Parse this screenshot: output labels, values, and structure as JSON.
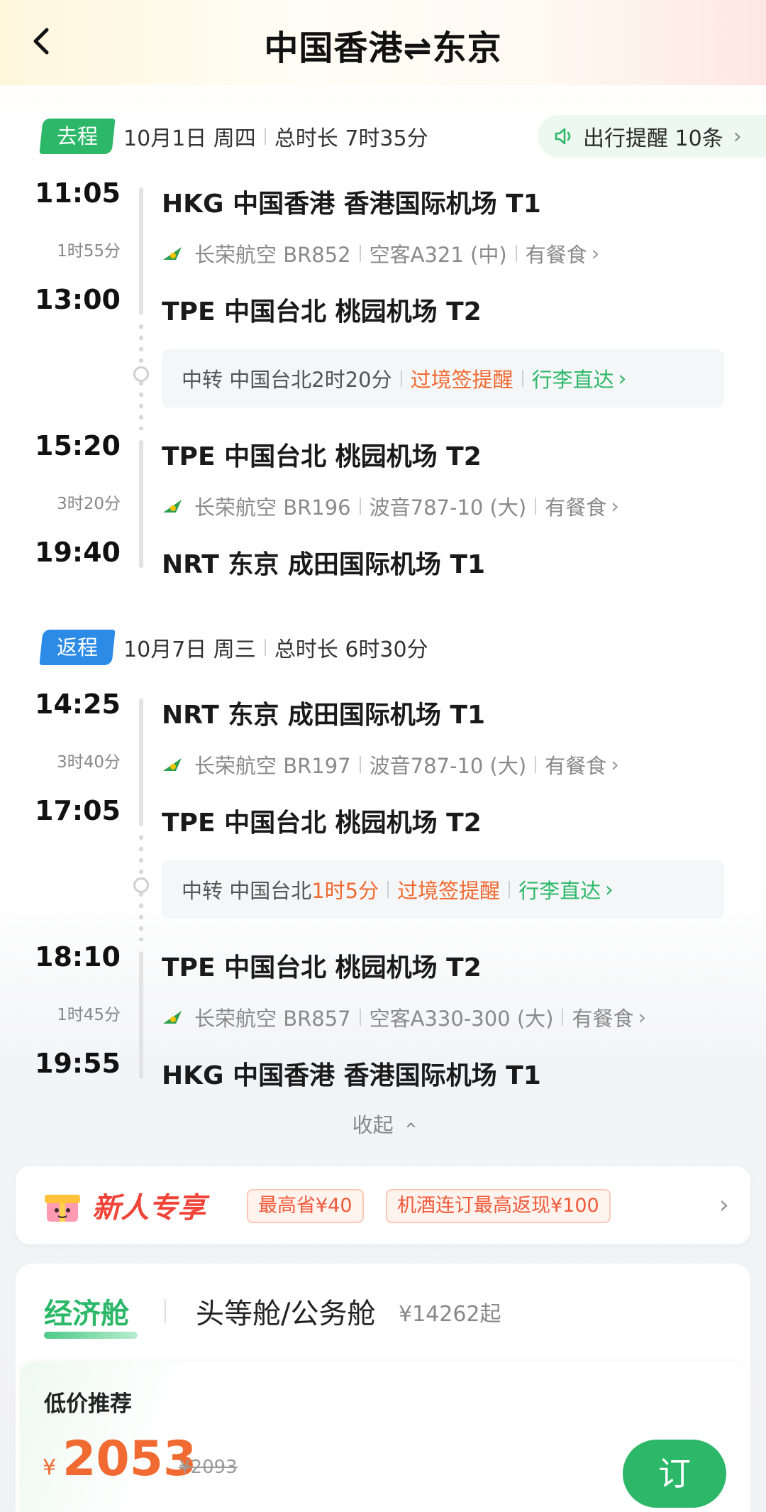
{
  "header": {
    "title": "中国香港⇌东京"
  },
  "outbound": {
    "tag": "去程",
    "date": "10月1日 周四",
    "total_duration": "总时长 7时35分",
    "reminder": "出行提醒 10条",
    "legs": [
      {
        "dep_time": "11:05",
        "duration": "1时55分",
        "arr_time": "13:00",
        "dep_airport": "HKG 中国香港 香港国际机场 T1",
        "airline": "长荣航空 BR852",
        "aircraft": "空客A321 (中)",
        "meal": "有餐食",
        "arr_airport": "TPE 中国台北 桃园机场 T2"
      },
      {
        "dep_time": "15:20",
        "duration": "3时20分",
        "arr_time": "19:40",
        "dep_airport": "TPE 中国台北 桃园机场 T2",
        "airline": "长荣航空 BR196",
        "aircraft": "波音787-10 (大)",
        "meal": "有餐食",
        "arr_airport": "NRT 东京 成田国际机场 T1"
      }
    ],
    "transfer": {
      "city": "中转 中国台北",
      "time": "2时20分",
      "visa": "过境签提醒",
      "baggage": "行李直达"
    }
  },
  "return": {
    "tag": "返程",
    "date": "10月7日 周三",
    "total_duration": "总时长 6时30分",
    "legs": [
      {
        "dep_time": "14:25",
        "duration": "3时40分",
        "arr_time": "17:05",
        "dep_airport": "NRT 东京 成田国际机场 T1",
        "airline": "长荣航空 BR197",
        "aircraft": "波音787-10 (大)",
        "meal": "有餐食",
        "arr_airport": "TPE 中国台北 桃园机场 T2"
      },
      {
        "dep_time": "18:10",
        "duration": "1时45分",
        "arr_time": "19:55",
        "dep_airport": "TPE 中国台北 桃园机场 T2",
        "airline": "长荣航空 BR857",
        "aircraft": "空客A330-300 (大)",
        "meal": "有餐食",
        "arr_airport": "HKG 中国香港 香港国际机场 T1"
      }
    ],
    "transfer": {
      "city": "中转 中国台北",
      "time": "1时5分",
      "visa": "过境签提醒",
      "baggage": "行李直达"
    }
  },
  "collapse_label": "收起",
  "promo": {
    "title": "新人专享",
    "tag1": "最高省¥40",
    "tag2": "机酒连订最高返现¥100"
  },
  "cabins": {
    "economy": "经济舱",
    "business": "头等舱/公务舱",
    "business_price": "¥14262起"
  },
  "offer": {
    "label": "低价推荐",
    "currency": "¥",
    "price": "2053",
    "original_price": "¥2093",
    "book": "订"
  },
  "colors": {
    "green": "#2cb868",
    "blue": "#2b8be6",
    "orange": "#f06a31",
    "promo_red": "#f04438"
  },
  "icons": {
    "back": "chevron-left-icon",
    "speaker": "speaker-icon",
    "airline": "eva-air-logo-icon",
    "gift": "gift-box-icon"
  }
}
